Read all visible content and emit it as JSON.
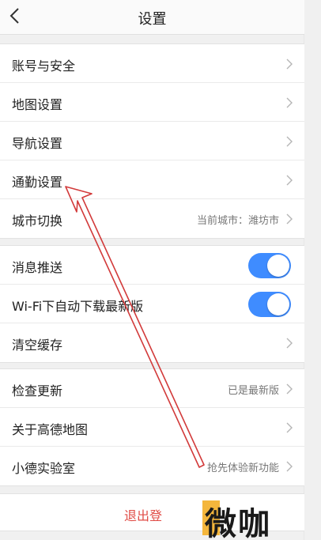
{
  "header": {
    "title": "设置",
    "back_icon": "back-arrow-icon"
  },
  "group1": {
    "items": [
      {
        "label": "账号与安全"
      },
      {
        "label": "地图设置"
      },
      {
        "label": "导航设置"
      },
      {
        "label": "通勤设置"
      },
      {
        "label": "城市切换",
        "value": "当前城市：潍坊市"
      }
    ]
  },
  "group2": {
    "items": [
      {
        "label": "消息推送",
        "toggle_on": true
      },
      {
        "label": "Wi-Fi下自动下载最新版",
        "toggle_on": true
      },
      {
        "label": "清空缓存"
      }
    ],
    "toggle_color": "#3f8cff"
  },
  "group3": {
    "items": [
      {
        "label": "检查更新",
        "value": "已是最新版"
      },
      {
        "label": "关于高德地图"
      },
      {
        "label": "小德实验室",
        "value": "抢先体验新功能"
      }
    ]
  },
  "logout": {
    "label": "退出登"
  },
  "watermark": {
    "text": "微咖"
  },
  "annotation": {
    "arrow_color": "#d23a3a"
  }
}
